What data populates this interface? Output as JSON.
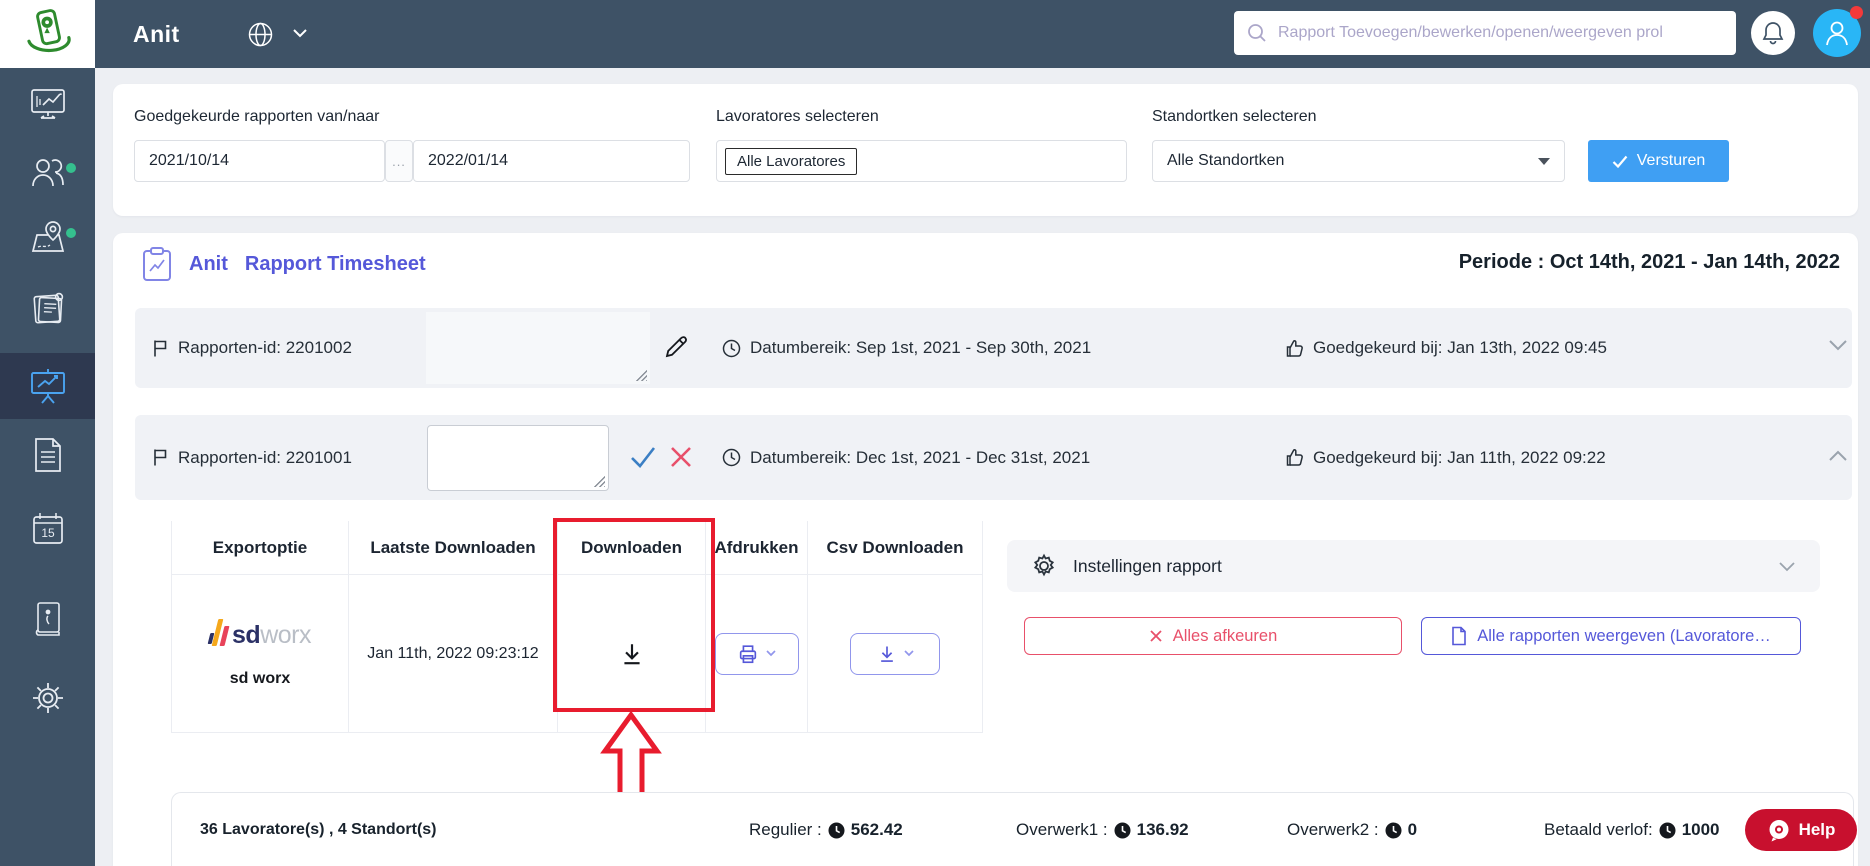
{
  "header": {
    "app_title": "Anit",
    "search_placeholder": "Rapport Toevoegen/bewerken/openen/weergeven prol"
  },
  "filters": {
    "date_label": "Goedgekeurde rapporten van/naar",
    "date_from": "2021/10/14",
    "date_separator": "...",
    "date_to": "2022/01/14",
    "lavoratores_label": "Lavoratores selecteren",
    "lavoratores_value": "Alle Lavoratores",
    "standortken_label": "Standortken selecteren",
    "standortken_value": "Alle Standortken",
    "submit_label": "Versturen"
  },
  "report": {
    "title_prefix": "Anit",
    "title": "Rapport Timesheet",
    "periode": "Periode : Oct 14th, 2021 - Jan 14th, 2022",
    "rows": [
      {
        "id_label": "Rapporten-id: 2201002",
        "datumbereik": "Datumbereik: Sep 1st, 2021 - Sep 30th, 2021",
        "goedgekeurd": "Goedgekeurd bij: Jan 13th, 2022 09:45"
      },
      {
        "id_label": "Rapporten-id: 2201001",
        "datumbereik": "Datumbereik: Dec 1st, 2021 - Dec 31st, 2021",
        "goedgekeurd": "Goedgekeurd bij: Jan 11th, 2022 09:22"
      }
    ]
  },
  "table": {
    "headers": [
      "Exportoptie",
      "Laatste Downloaden",
      "Downloaden",
      "Afdrukken",
      "Csv Downloaden"
    ],
    "row": {
      "brand_sd": "sd",
      "brand_worx": "worx",
      "export_name": "sd worx",
      "last_download": "Jan 11th, 2022 09:23:12"
    }
  },
  "settings": {
    "label": "Instellingen rapport"
  },
  "actions": {
    "reject_all": "Alles afkeuren",
    "show_all": "Alle rapporten weergeven (Lavoratore…"
  },
  "summary": {
    "counts": "36 Lavoratore(s) , 4 Standort(s)",
    "items": [
      {
        "label": "Regulier :",
        "value": "562.42"
      },
      {
        "label": "Overwerk1 :",
        "value": "136.92"
      },
      {
        "label": "Overwerk2 :",
        "value": "0"
      },
      {
        "label": "Betaald verlof:",
        "value": "1000"
      }
    ]
  },
  "help": {
    "label": "Help"
  },
  "colors": {
    "sidebar": "#3e5266",
    "accent_purple": "#5558d9",
    "submit_blue": "#3f9ff3",
    "avatar_blue": "#29b6f6",
    "green_dot": "#35c08e",
    "highlight_red": "#e81c2e",
    "help_red": "#c8102e",
    "reject_red": "#e8506a",
    "confirm_check_blue": "#3b7fc4",
    "sdworx_navy": "#2b3166",
    "sdworx_yellow": "#f5a81c",
    "sdworx_red": "#e8435a"
  }
}
